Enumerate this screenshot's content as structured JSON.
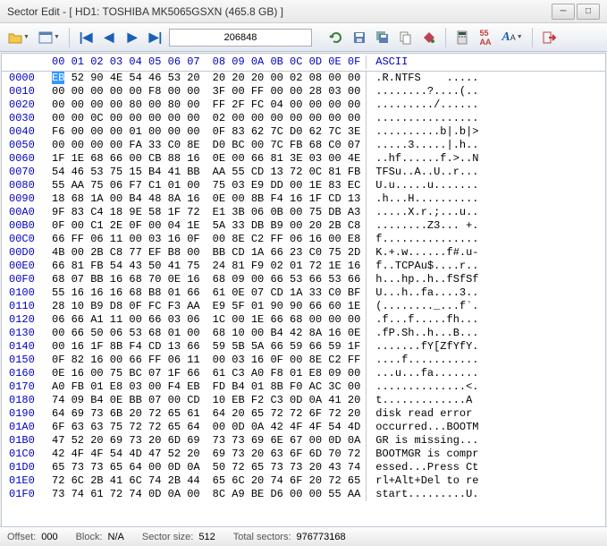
{
  "window": {
    "title": "Sector Edit - [ HD1: TOSHIBA MK5065GSXN (465.8 GB) ]"
  },
  "toolbar": {
    "sector_value": "206848"
  },
  "header": {
    "cols1": [
      "00",
      "01",
      "02",
      "03",
      "04",
      "05",
      "06",
      "07"
    ],
    "cols2": [
      "08",
      "09",
      "0A",
      "0B",
      "0C",
      "0D",
      "0E",
      "0F"
    ],
    "ascii": "ASCII"
  },
  "rows": [
    {
      "off": "0000",
      "h1": "EB 52 90 4E 54 46 53 20",
      "h2": "20 20 20 00 02 08 00 00",
      "a": ".R.NTFS    ....."
    },
    {
      "off": "0010",
      "h1": "00 00 00 00 00 F8 00 00",
      "h2": "3F 00 FF 00 00 28 03 00",
      "a": "........?....(.."
    },
    {
      "off": "0020",
      "h1": "00 00 00 00 80 00 80 00",
      "h2": "FF 2F FC 04 00 00 00 00",
      "a": "........./......"
    },
    {
      "off": "0030",
      "h1": "00 00 0C 00 00 00 00 00",
      "h2": "02 00 00 00 00 00 00 00",
      "a": "................"
    },
    {
      "off": "0040",
      "h1": "F6 00 00 00 01 00 00 00",
      "h2": "0F 83 62 7C D0 62 7C 3E",
      "a": "..........b|.b|>"
    },
    {
      "off": "0050",
      "h1": "00 00 00 00 FA 33 C0 8E",
      "h2": "D0 BC 00 7C FB 68 C0 07",
      "a": ".....3.....|.h.."
    },
    {
      "off": "0060",
      "h1": "1F 1E 68 66 00 CB 88 16",
      "h2": "0E 00 66 81 3E 03 00 4E",
      "a": "..hf......f.>..N"
    },
    {
      "off": "0070",
      "h1": "54 46 53 75 15 B4 41 BB",
      "h2": "AA 55 CD 13 72 0C 81 FB",
      "a": "TFSu..A..U..r..."
    },
    {
      "off": "0080",
      "h1": "55 AA 75 06 F7 C1 01 00",
      "h2": "75 03 E9 DD 00 1E 83 EC",
      "a": "U.u.....u......."
    },
    {
      "off": "0090",
      "h1": "18 68 1A 00 B4 48 8A 16",
      "h2": "0E 00 8B F4 16 1F CD 13",
      "a": ".h...H.........."
    },
    {
      "off": "00A0",
      "h1": "9F 83 C4 18 9E 58 1F 72",
      "h2": "E1 3B 06 0B 00 75 DB A3",
      "a": ".....X.r.;...u.."
    },
    {
      "off": "00B0",
      "h1": "0F 00 C1 2E 0F 00 04 1E",
      "h2": "5A 33 DB B9 00 20 2B C8",
      "a": "........Z3... +."
    },
    {
      "off": "00C0",
      "h1": "66 FF 06 11 00 03 16 0F",
      "h2": "00 8E C2 FF 06 16 00 E8",
      "a": "f..............."
    },
    {
      "off": "00D0",
      "h1": "4B 00 2B C8 77 EF B8 00",
      "h2": "BB CD 1A 66 23 C0 75 2D",
      "a": "K.+.w......f#.u-"
    },
    {
      "off": "00E0",
      "h1": "66 81 FB 54 43 50 41 75",
      "h2": "24 81 F9 02 01 72 1E 16",
      "a": "f..TCPAu$....r.."
    },
    {
      "off": "00F0",
      "h1": "68 07 BB 16 68 70 0E 16",
      "h2": "68 09 00 66 53 66 53 66",
      "a": "h...hp..h..fSfSf"
    },
    {
      "off": "0100",
      "h1": "55 16 16 16 68 B8 01 66",
      "h2": "61 0E 07 CD 1A 33 C0 BF",
      "a": "U...h..fa....3.."
    },
    {
      "off": "0110",
      "h1": "28 10 B9 D8 0F FC F3 AA",
      "h2": "E9 5F 01 90 90 66 60 1E",
      "a": "(........_...f`."
    },
    {
      "off": "0120",
      "h1": "06 66 A1 11 00 66 03 06",
      "h2": "1C 00 1E 66 68 00 00 00",
      "a": ".f...f.....fh..."
    },
    {
      "off": "0130",
      "h1": "00 66 50 06 53 68 01 00",
      "h2": "68 10 00 B4 42 8A 16 0E",
      "a": ".fP.Sh..h...B..."
    },
    {
      "off": "0140",
      "h1": "00 16 1F 8B F4 CD 13 66",
      "h2": "59 5B 5A 66 59 66 59 1F",
      "a": ".......fY[ZfYfY."
    },
    {
      "off": "0150",
      "h1": "0F 82 16 00 66 FF 06 11",
      "h2": "00 03 16 0F 00 8E C2 FF",
      "a": "....f..........."
    },
    {
      "off": "0160",
      "h1": "0E 16 00 75 BC 07 1F 66",
      "h2": "61 C3 A0 F8 01 E8 09 00",
      "a": "...u...fa......."
    },
    {
      "off": "0170",
      "h1": "A0 FB 01 E8 03 00 F4 EB",
      "h2": "FD B4 01 8B F0 AC 3C 00",
      "a": "..............<."
    },
    {
      "off": "0180",
      "h1": "74 09 B4 0E BB 07 00 CD",
      "h2": "10 EB F2 C3 0D 0A 41 20",
      "a": "t.............A "
    },
    {
      "off": "0190",
      "h1": "64 69 73 6B 20 72 65 61",
      "h2": "64 20 65 72 72 6F 72 20",
      "a": "disk read error "
    },
    {
      "off": "01A0",
      "h1": "6F 63 63 75 72 72 65 64",
      "h2": "00 0D 0A 42 4F 4F 54 4D",
      "a": "occurred...BOOTM"
    },
    {
      "off": "01B0",
      "h1": "47 52 20 69 73 20 6D 69",
      "h2": "73 73 69 6E 67 00 0D 0A",
      "a": "GR is missing..."
    },
    {
      "off": "01C0",
      "h1": "42 4F 4F 54 4D 47 52 20",
      "h2": "69 73 20 63 6F 6D 70 72",
      "a": "BOOTMGR is compr"
    },
    {
      "off": "01D0",
      "h1": "65 73 73 65 64 00 0D 0A",
      "h2": "50 72 65 73 73 20 43 74",
      "a": "essed...Press Ct"
    },
    {
      "off": "01E0",
      "h1": "72 6C 2B 41 6C 74 2B 44",
      "h2": "65 6C 20 74 6F 20 72 65",
      "a": "rl+Alt+Del to re"
    },
    {
      "off": "01F0",
      "h1": "73 74 61 72 74 0D 0A 00",
      "h2": "8C A9 BE D6 00 00 55 AA",
      "a": "start.........U."
    }
  ],
  "status": {
    "offset_label": "Offset:",
    "offset_value": "000",
    "block_label": "Block:",
    "block_value": "N/A",
    "sectorsize_label": "Sector size:",
    "sectorsize_value": "512",
    "totalsectors_label": "Total sectors:",
    "totalsectors_value": "976773168"
  }
}
